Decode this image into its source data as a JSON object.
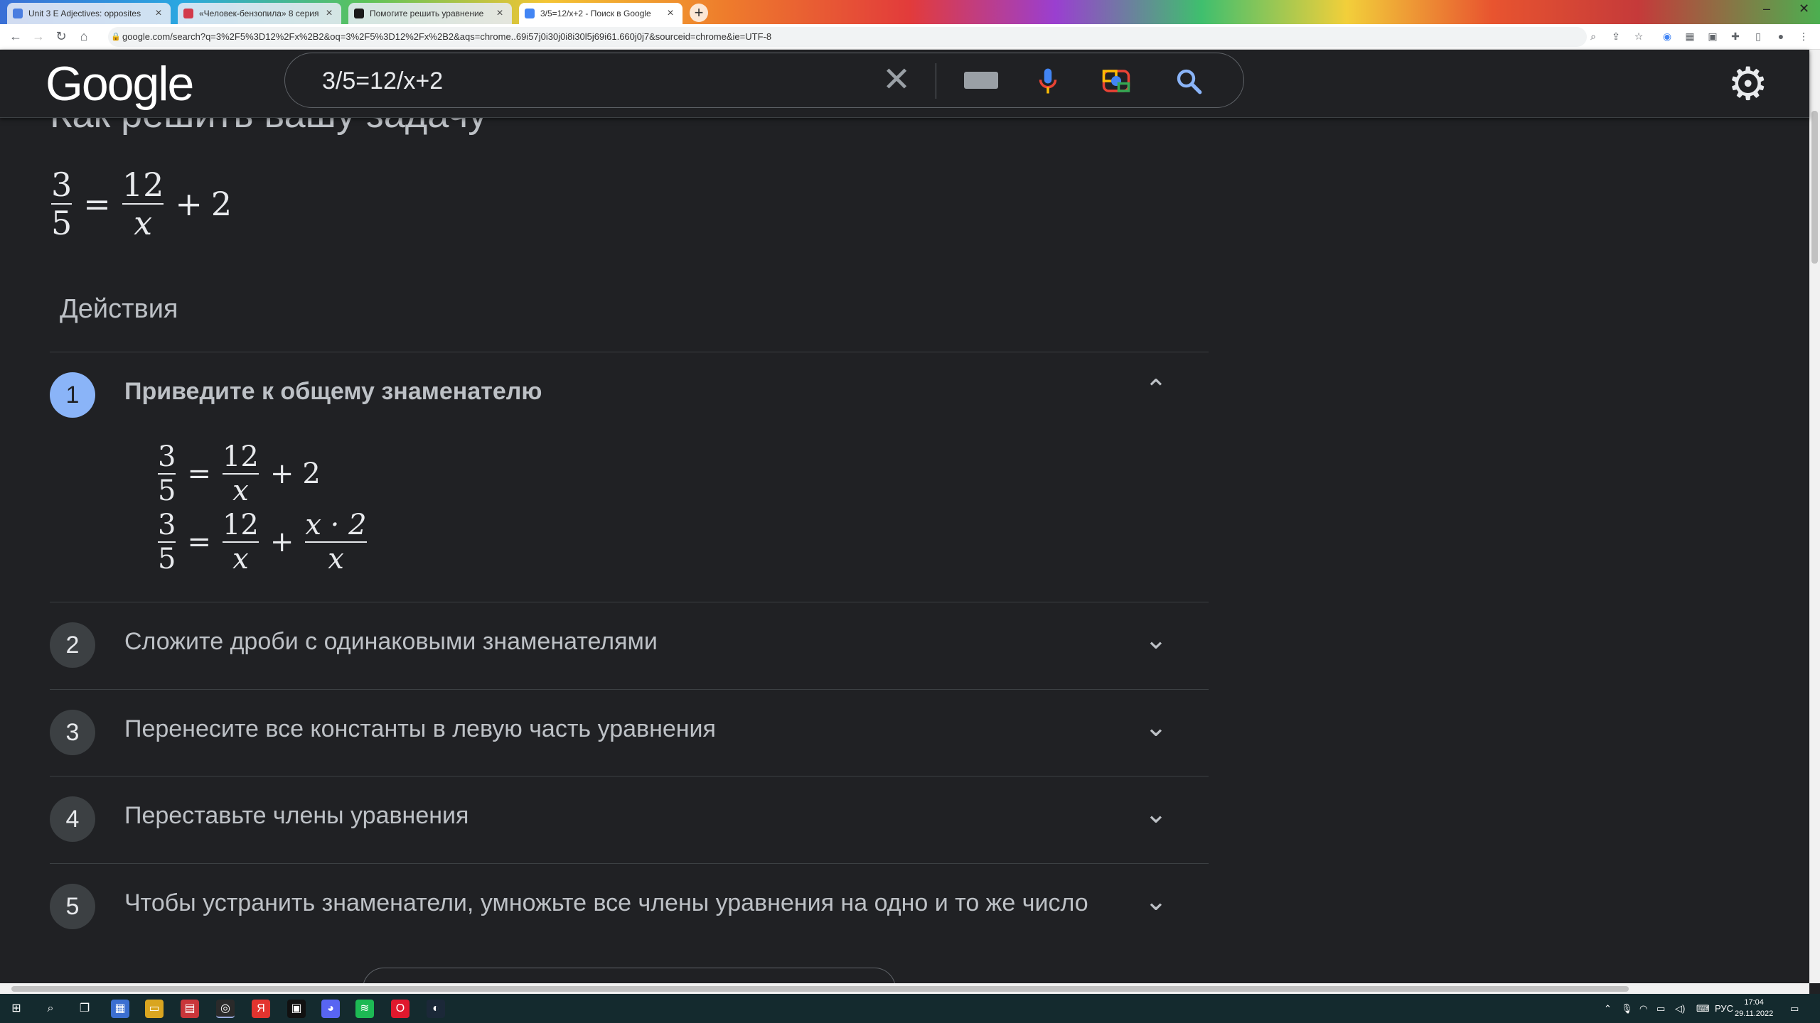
{
  "browser": {
    "tabs": [
      {
        "label": "Unit 3 E Adjectives: opposites",
        "favicon_color": "#4a7de0",
        "active": false
      },
      {
        "label": "«Человек-бензопила» 8 серия",
        "favicon_color": "#d23a4b",
        "active": false
      },
      {
        "label": "Помогите решить уравнение",
        "favicon_color": "#1a1a1a",
        "active": false
      },
      {
        "label": "3/5=12/x+2 - Поиск в Google",
        "favicon_color": "#4285f4",
        "active": true
      }
    ],
    "new_tab_glyph": "+",
    "close_glyph": "×",
    "url": "google.com/search?q=3%2F5%3D12%2Fx%2B2&oq=3%2F5%3D12%2Fx%2B2&aqs=chrome..69i57j0i30j0i8i30l5j69i61.660j0j7&sourceid=chrome&ie=UTF-8"
  },
  "google": {
    "logo": "Google",
    "query": "3/5=12/x+2",
    "clear_glyph": "✕"
  },
  "solver": {
    "title": "Как решить вашу задачу",
    "equation": {
      "num1": "3",
      "den1": "5",
      "eq": "=",
      "num2": "12",
      "den2": "x",
      "plus": "+",
      "const": "2"
    },
    "actions_heading": "Действия",
    "steps": [
      {
        "number": "1",
        "label": "Приведите к общему знаменателю",
        "expanded": true
      },
      {
        "number": "2",
        "label": "Сложите дроби с одинаковыми знаменателями",
        "expanded": false
      },
      {
        "number": "3",
        "label": "Перенесите все константы в левую часть уравнения",
        "expanded": false
      },
      {
        "number": "4",
        "label": "Переставьте члены уравнения",
        "expanded": false
      },
      {
        "number": "5",
        "label": "Чтобы устранить знаменатели, умножьте все члены уравнения на одно и то же число",
        "expanded": false
      }
    ],
    "step1_line1": {
      "num1": "3",
      "den1": "5",
      "eq": "=",
      "num2": "12",
      "den2": "x",
      "plus": "+",
      "const": "2"
    },
    "step1_line2": {
      "num1": "3",
      "den1": "5",
      "eq": "=",
      "num2": "12",
      "den2": "x",
      "plus": "+",
      "num3": "x · 2",
      "den3": "x"
    }
  },
  "taskbar": {
    "language": "РУС",
    "time": "17:04",
    "date": "29.11.2022"
  }
}
